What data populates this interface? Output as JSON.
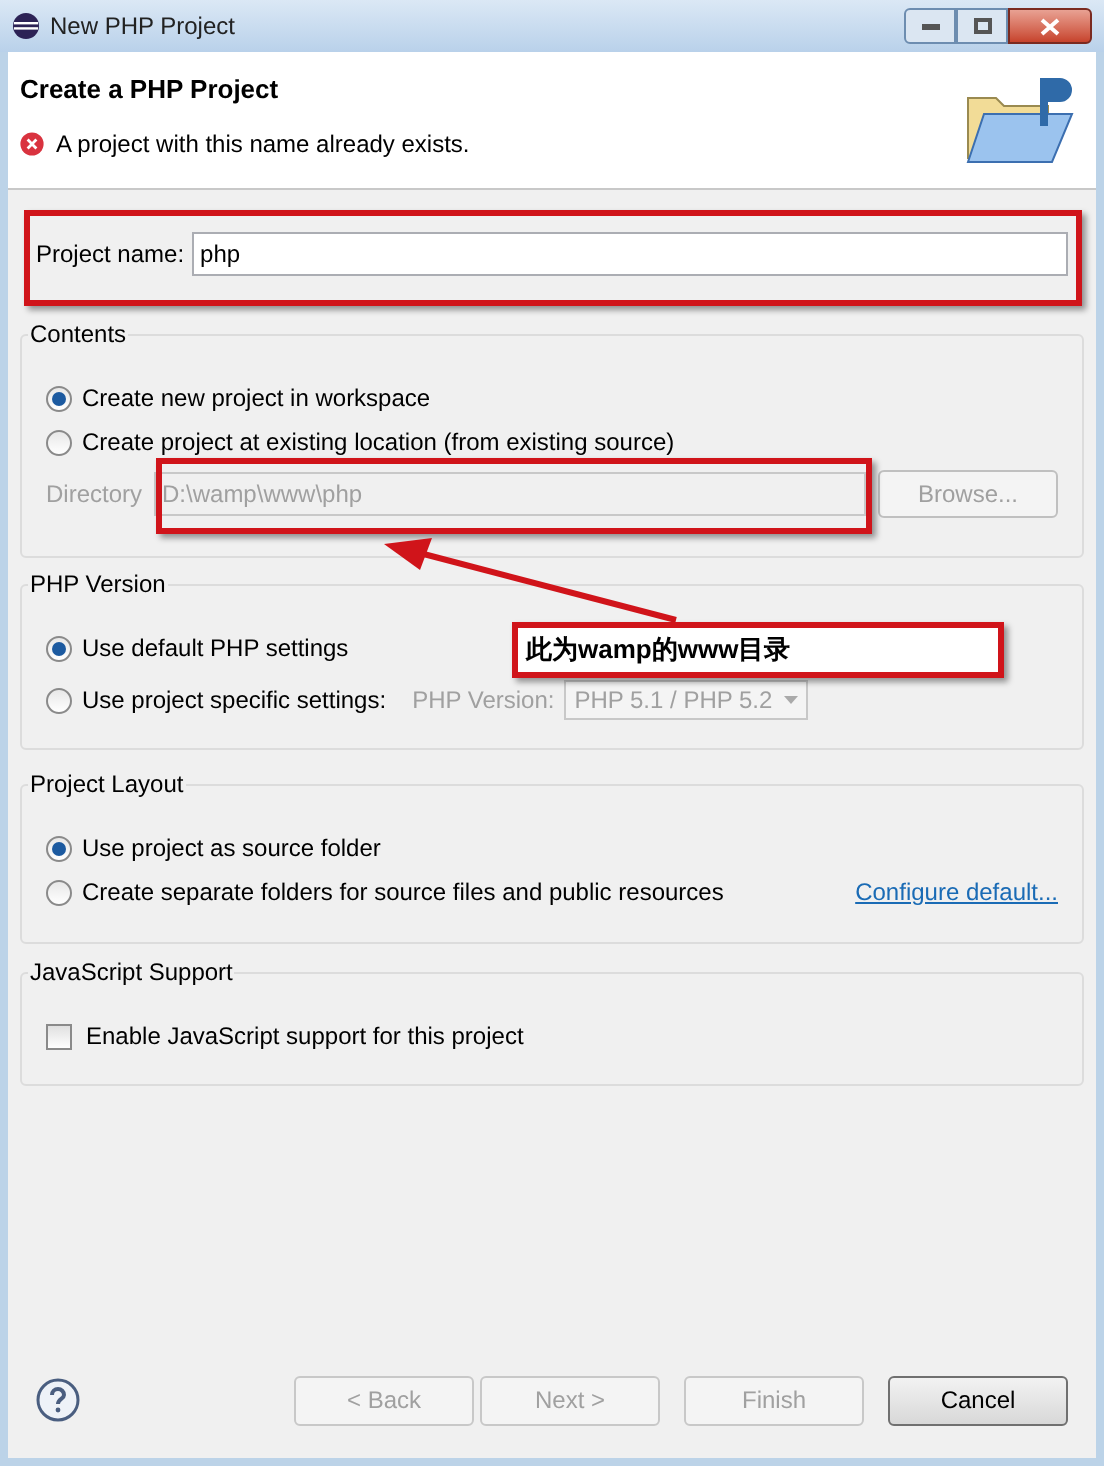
{
  "window": {
    "title": "New PHP Project"
  },
  "header": {
    "title": "Create a PHP Project",
    "message": "A project with this name already exists."
  },
  "project_name": {
    "label": "Project name:",
    "value": "php"
  },
  "contents": {
    "title": "Contents",
    "options": [
      {
        "label": "Create new project in workspace",
        "selected": true
      },
      {
        "label": "Create project at existing location (from existing source)",
        "selected": false
      }
    ],
    "directory": {
      "label": "Directory",
      "value": "D:\\wamp\\www\\php",
      "disabled": true
    },
    "browse": {
      "label": "Browse...",
      "disabled": true
    }
  },
  "php_version": {
    "title": "PHP Version",
    "options": [
      {
        "label": "Use default PHP settings",
        "selected": true
      },
      {
        "label": "Use project specific settings:",
        "selected": false
      }
    ],
    "version_label": "PHP Version:",
    "version_value": "PHP 5.1 / PHP 5.2",
    "disabled": true
  },
  "project_layout": {
    "title": "Project Layout",
    "options": [
      {
        "label": "Use project as source folder",
        "selected": true
      },
      {
        "label": "Create separate folders for source files and public resources",
        "selected": false
      }
    ],
    "link": "Configure default..."
  },
  "javascript": {
    "title": "JavaScript Support",
    "checkbox": {
      "label": "Enable JavaScript support for this project",
      "checked": false
    }
  },
  "annotation": {
    "text": "此为wamp的www目录"
  },
  "buttons": [
    {
      "label": "< Back",
      "disabled": true
    },
    {
      "label": "Next >",
      "disabled": true
    },
    {
      "label": "Finish",
      "disabled": true
    },
    {
      "label": "Cancel",
      "disabled": false
    }
  ]
}
